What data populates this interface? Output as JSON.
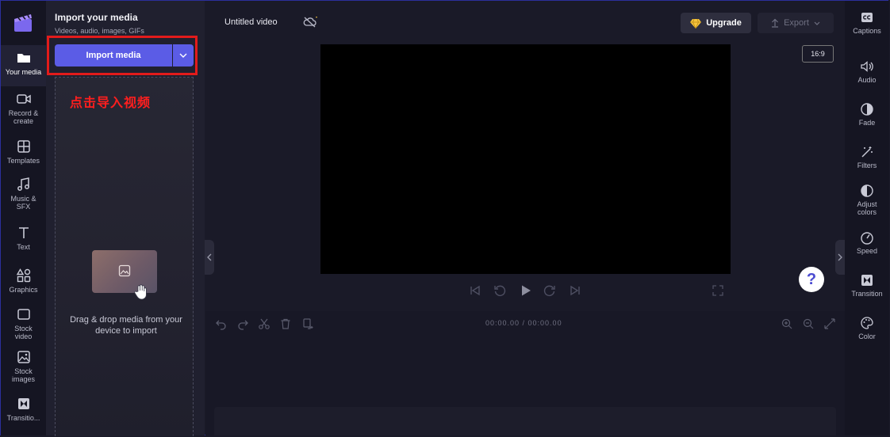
{
  "left_rail": {
    "items": [
      {
        "label": "Your media",
        "icon": "folder-icon"
      },
      {
        "label": "Record & create",
        "icon": "camera-icon"
      },
      {
        "label": "Templates",
        "icon": "templates-icon"
      },
      {
        "label": "Music & SFX",
        "icon": "music-icon"
      },
      {
        "label": "Text",
        "icon": "text-icon"
      },
      {
        "label": "Graphics",
        "icon": "graphics-icon"
      },
      {
        "label": "Stock video",
        "icon": "stock-video-icon"
      },
      {
        "label": "Stock images",
        "icon": "stock-images-icon"
      },
      {
        "label": "Transitio...",
        "icon": "transition-icon"
      }
    ]
  },
  "media_panel": {
    "title": "Import your media",
    "subtitle": "Videos, audio, images, GIFs",
    "import_label": "Import media",
    "annotation": "点击导入视频",
    "drop_text": "Drag & drop media from your device to import"
  },
  "header": {
    "video_title": "Untitled video",
    "upgrade_label": "Upgrade",
    "export_label": "Export",
    "aspect_ratio": "16:9"
  },
  "player": {
    "time_readout": "00:00.00 / 00:00.00"
  },
  "right_rail": {
    "items": [
      {
        "label": "Captions",
        "icon": "captions-icon"
      },
      {
        "label": "Audio",
        "icon": "speaker-icon"
      },
      {
        "label": "Fade",
        "icon": "fade-icon"
      },
      {
        "label": "Filters",
        "icon": "filters-icon"
      },
      {
        "label": "Adjust colors",
        "icon": "adjust-colors-icon"
      },
      {
        "label": "Speed",
        "icon": "speed-icon"
      },
      {
        "label": "Transition",
        "icon": "transition-icon"
      },
      {
        "label": "Color",
        "icon": "palette-icon"
      }
    ]
  },
  "colors": {
    "accent": "#5b5ce6",
    "highlight": "#e21b1b",
    "annotation": "#ff1e1e",
    "upgrade_gem": "#f6c33c"
  }
}
